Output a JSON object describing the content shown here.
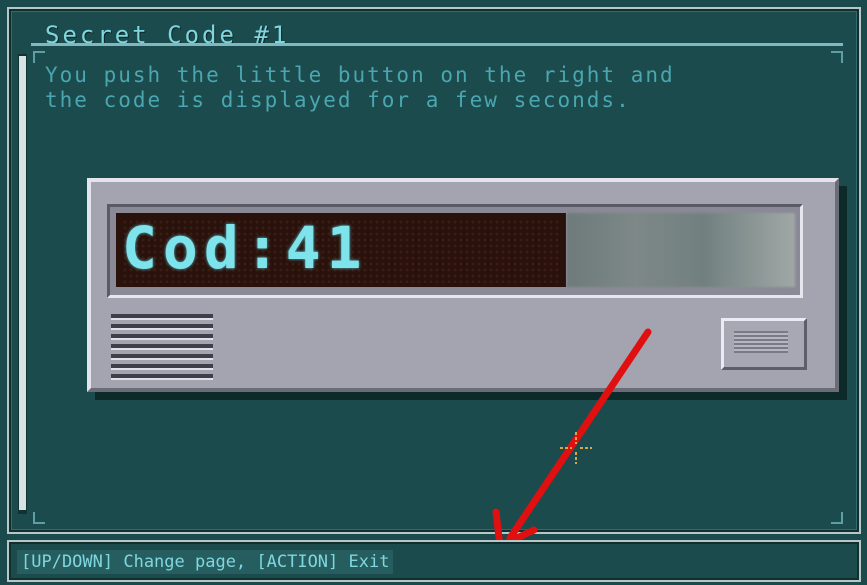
{
  "window": {
    "title": "Secret Code #1",
    "description": "You push the little button on the right and\nthe code is displayed for a few seconds."
  },
  "device": {
    "display_code": "Cod:41",
    "button_label": ""
  },
  "footer": {
    "hint": "[UP/DOWN] Change page, [ACTION] Exit"
  },
  "colors": {
    "panel_bg": "#1b4b4d",
    "text_accent": "#7fd6df",
    "led_on": "#7fe3ec",
    "arrow": "#e01010"
  }
}
